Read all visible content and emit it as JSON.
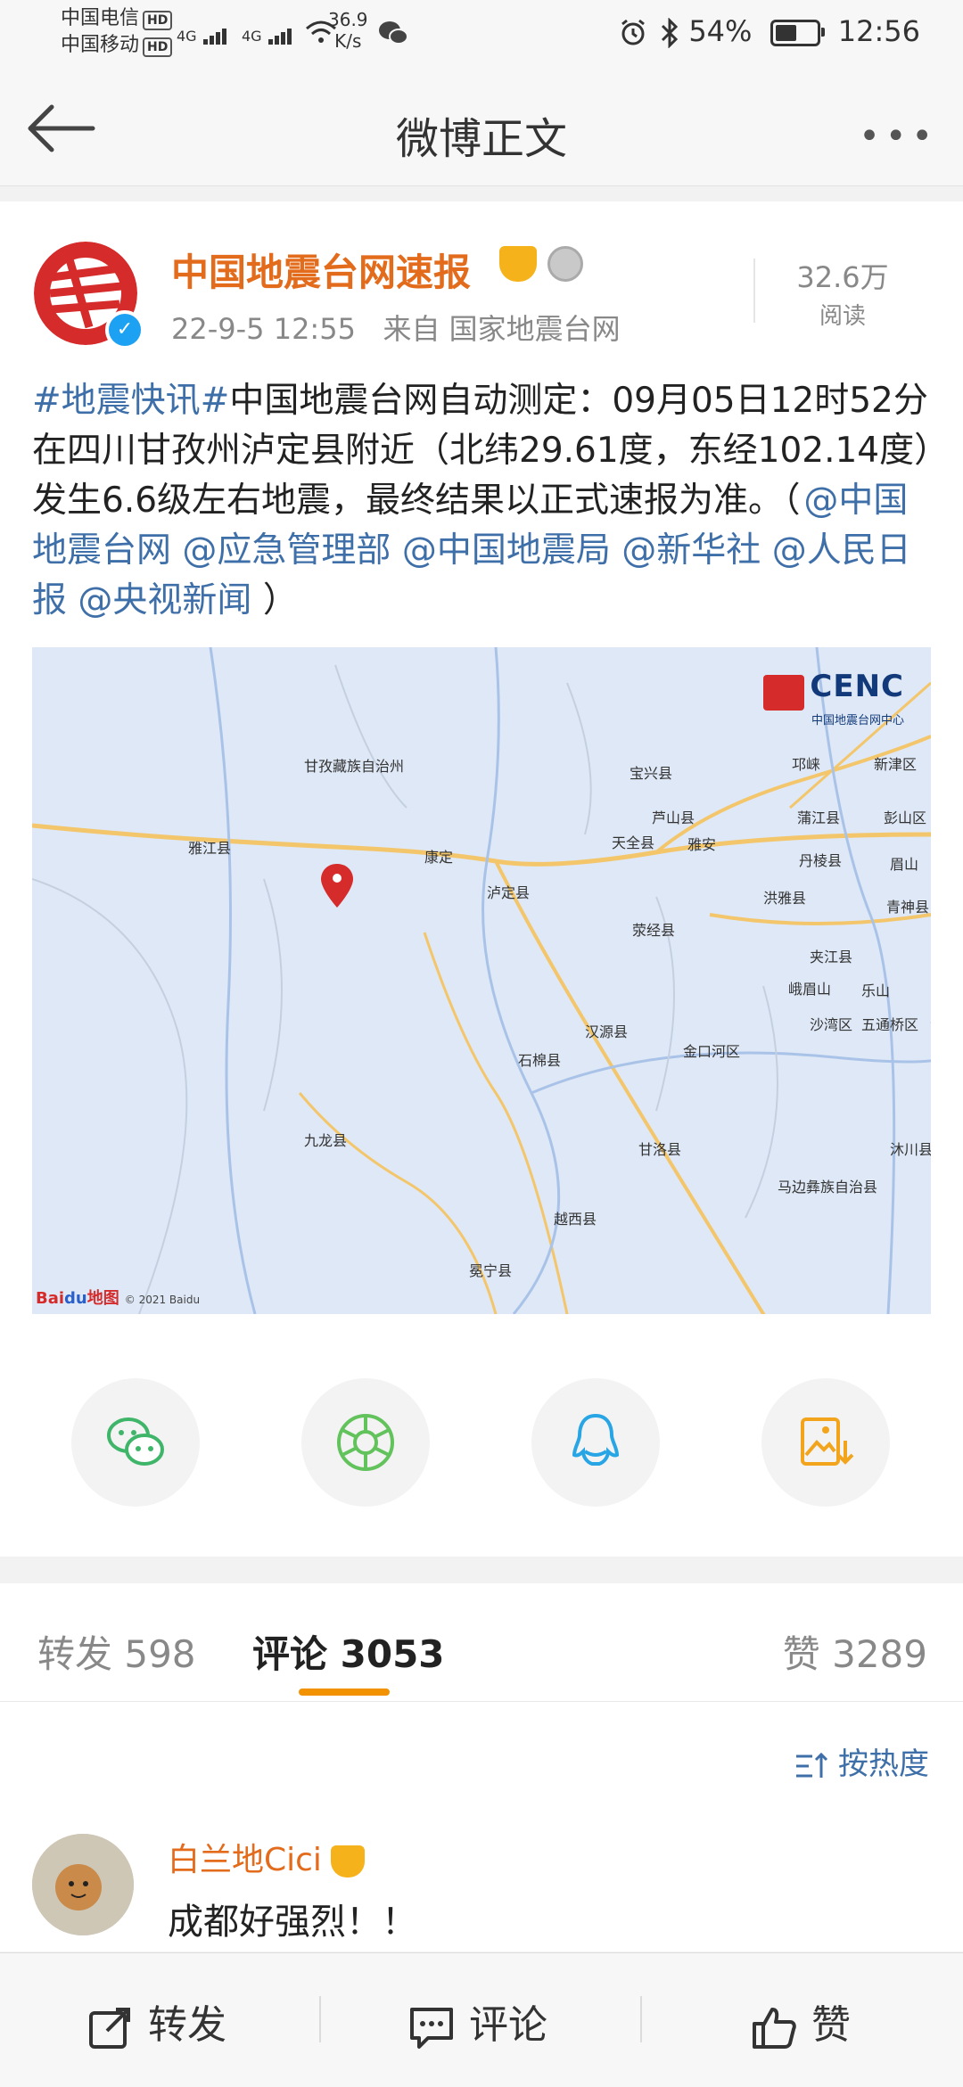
{
  "status_bar": {
    "carrier1": "中国电信",
    "carrier2": "中国移动",
    "hd": "HD",
    "network": "4G",
    "speed_value": "36.9",
    "speed_unit": "K/s",
    "battery": "54%",
    "time": "12:56",
    "battery_level_fraction": 0.54
  },
  "nav": {
    "title": "微博正文"
  },
  "post": {
    "author": "中国地震台网速报",
    "timestamp": "22-9-5 12:55",
    "source": "来自 国家地震台网",
    "reads_count": "32.6万",
    "reads_label": "阅读",
    "hashtag": "#地震快讯#",
    "body": "中国地震台网自动测定：09月05日12时52分在四川甘孜州泸定县附近（北纬29.61度，东经102.14度）发生6.6级左右地震，最终结果以正式速报为准。（",
    "mentions": [
      "@中国地震台网",
      "@应急管理部",
      "@中国地震局",
      "@新华社",
      "@人民日报",
      "@央视新闻"
    ],
    "close_paren": "）"
  },
  "map": {
    "logo": "CENC",
    "logo_sub": "中国地震台网中心",
    "labels": [
      "甘孜藏族自治州",
      "宝兴县",
      "邛崃",
      "新津区",
      "芦山县",
      "蒲江县",
      "彭山区",
      "雅江县",
      "康定",
      "天全县",
      "雅安",
      "丹棱县",
      "眉山",
      "泸定县",
      "荥经县",
      "洪雅县",
      "青神县",
      "夹江县",
      "峨眉山",
      "乐山",
      "汉源县",
      "沙湾区",
      "五通桥区",
      "石棉县",
      "金口河区",
      "九龙县",
      "甘洛县",
      "沐川县",
      "马边彝族自治县",
      "越西县",
      "冕宁县"
    ],
    "baidu": "Bai",
    "baidu2": "du",
    "baidu3": "地图",
    "copyright": "© 2021 Baidu"
  },
  "share_icons": [
    "wechat-icon",
    "moments-icon",
    "qq-icon",
    "save-image-icon"
  ],
  "tabs": {
    "repost": "转发 598",
    "comment": "评论 3053",
    "like": "赞 3289"
  },
  "comments": {
    "sort_label": "按热度",
    "items": [
      {
        "author": "白兰地Cici",
        "text": "成都好强烈！！"
      }
    ]
  },
  "toolbar": {
    "repost": "转发",
    "comment": "评论",
    "like": "赞"
  },
  "colors": {
    "accent_orange": "#e36b1c",
    "link_blue": "#3e6fa8",
    "tab_underline": "#f39200"
  }
}
